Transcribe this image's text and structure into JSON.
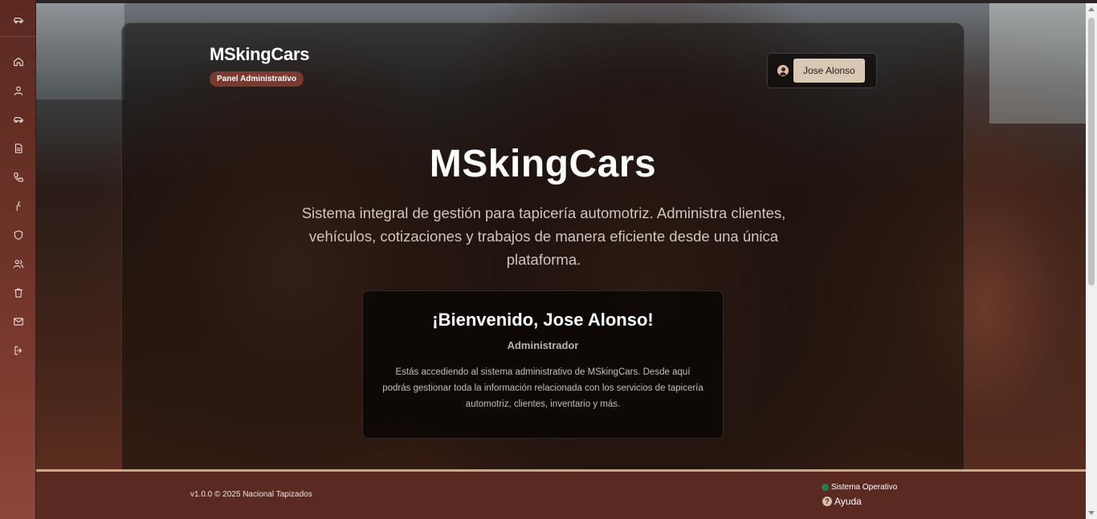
{
  "sidebar": {
    "logo_icon": "car-icon",
    "items": [
      {
        "icon": "home-icon"
      },
      {
        "icon": "user-icon"
      },
      {
        "icon": "car-icon"
      },
      {
        "icon": "document-icon"
      },
      {
        "icon": "phone-icon"
      },
      {
        "icon": "tools-icon"
      },
      {
        "icon": "shield-icon"
      },
      {
        "icon": "users-icon"
      },
      {
        "icon": "trash-icon"
      },
      {
        "icon": "mail-icon"
      },
      {
        "icon": "logout-icon"
      }
    ]
  },
  "header": {
    "brand": "MSkingCars",
    "badge": "Panel Administrativo",
    "user_name": "Jose Alonso"
  },
  "hero": {
    "title": "MSkingCars",
    "subtitle": "Sistema integral de gestión para tapicería automotriz. Administra clientes, vehículos, cotizaciones y trabajos de manera eficiente desde una única plataforma."
  },
  "welcome": {
    "title": "¡Bienvenido, Jose Alonso!",
    "role": "Administrador",
    "text": "Estás accediendo al sistema administrativo de MSkingCars. Desde aquí podrás gestionar toda la información relacionada con los servicios de tapicería automotriz, clientes, inventario y más."
  },
  "footer": {
    "version": "v1.0.0 © 2025 Nacional Tapizados",
    "status": "Sistema Operativo",
    "status_color": "#2b7a4f",
    "help": "Ayuda"
  },
  "colors": {
    "accent": "#7a3a30",
    "sidebar": "#6e3328",
    "footer": "#5a2a22",
    "footer_border": "#c9a980"
  }
}
